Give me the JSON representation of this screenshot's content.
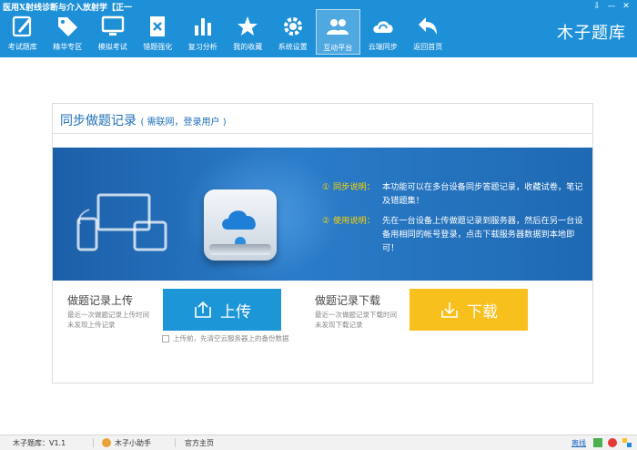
{
  "window": {
    "title": "医用X射线诊断与介入放射学【正一",
    "controls": [
      "⇩",
      "—",
      "✕"
    ]
  },
  "brand": "木子题库",
  "nav": [
    {
      "label": "考试题库",
      "icon": "pen-check-icon"
    },
    {
      "label": "精华专区",
      "icon": "tag-icon"
    },
    {
      "label": "模拟考试",
      "icon": "monitor-icon"
    },
    {
      "label": "错题强化",
      "icon": "wrong-doc-icon"
    },
    {
      "label": "复习分析",
      "icon": "bar-chart-icon"
    },
    {
      "label": "我的收藏",
      "icon": "star-icon"
    },
    {
      "label": "系统设置",
      "icon": "gear-icon"
    },
    {
      "label": "互动平台",
      "icon": "users-icon",
      "active": true
    },
    {
      "label": "云端同步",
      "icon": "cloud-sync-icon"
    },
    {
      "label": "返回首页",
      "icon": "back-arrow-icon"
    }
  ],
  "card": {
    "title": "同步做题记录",
    "subtitle": "( 需联网，登录用户 )"
  },
  "banner": {
    "item1_num": "①",
    "item1_key": "同步说明：",
    "item1_text": "本功能可以在多台设备同步答题记录，收藏试卷，笔记及错题集！",
    "item2_num": "②",
    "item2_key": "使用说明：",
    "item2_text": "先在一台设备上传做题记录到服务器，然后在另一台设备用相同的帐号登录，点击下载服务器数据到本地即可！"
  },
  "upload": {
    "title": "做题记录上传",
    "desc_line1": "最近一次做题记录上传时间",
    "desc_line2": "未发现上传记录",
    "button": "上传",
    "checkbox_label": "上传前，先清空云服务器上的备份数据"
  },
  "download": {
    "title": "做题记录下载",
    "desc_line1": "最近一次做题记录下载时间",
    "desc_line2": "未发现下载记录",
    "button": "下载"
  },
  "status": {
    "app": "木子题库：V1.1",
    "helper": "木子小助手",
    "homepage": "官方主页",
    "exit": "离线"
  },
  "colors": {
    "topbar": "#1e90d8",
    "upload": "#1d96d8",
    "download": "#f8c01c",
    "banner": "#2a7cc9"
  }
}
